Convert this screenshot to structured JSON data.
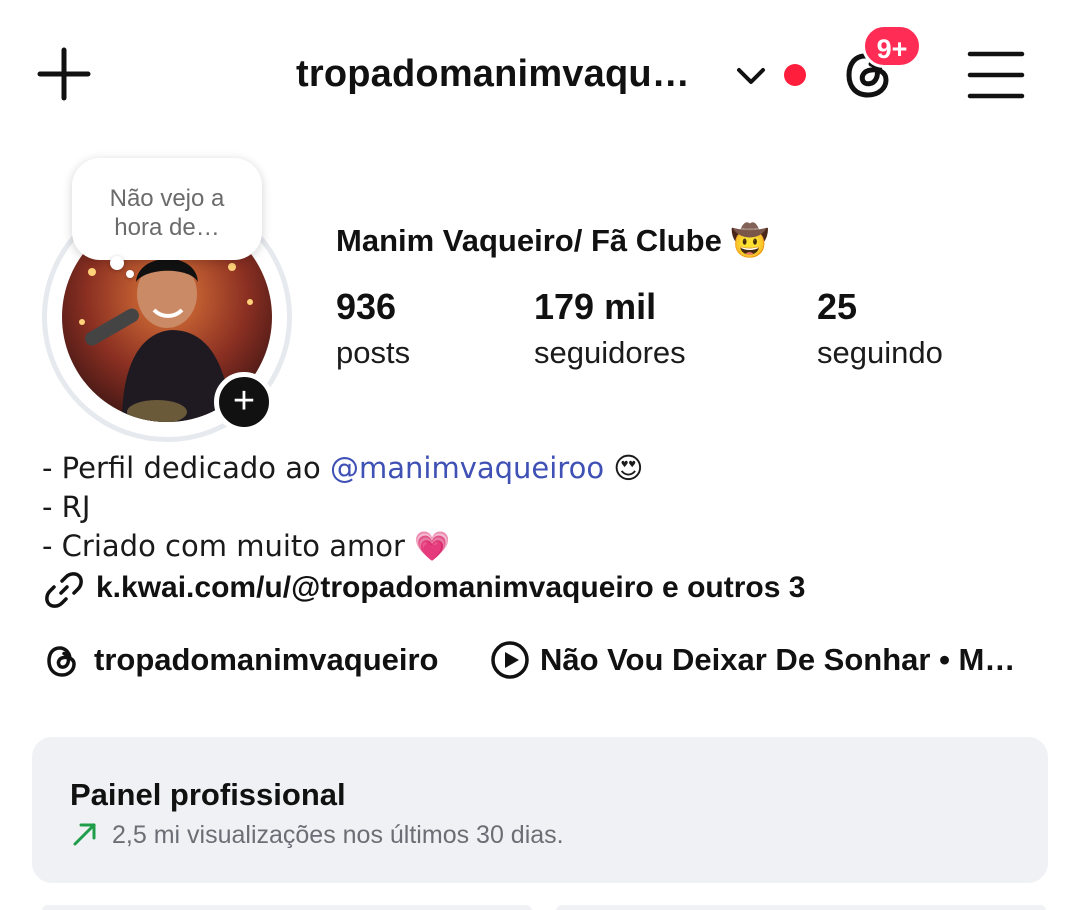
{
  "colors": {
    "text": "#111111",
    "badge_red": "#ff2d55",
    "live_dot": "#ff1e3c",
    "mention_blue": "#3f51b5",
    "trend_green": "#1e9e4a",
    "card_bg": "#eff1f4"
  },
  "header": {
    "new_post_icon": "plus-icon",
    "username": "tropadomanimvaqu…",
    "account_switch_icon": "chevron-down-icon",
    "threads_icon": "threads-icon",
    "notification_badge": "9+",
    "menu_icon": "hamburger-menu-icon"
  },
  "note": {
    "text_line1": "Não vejo a",
    "text_line2": "hora de…"
  },
  "profile": {
    "display_name": "Manim Vaqueiro/ Fã Clube 🤠",
    "add_story_label": "+",
    "stats": [
      {
        "value": "936",
        "label": "posts"
      },
      {
        "value": "179 mil",
        "label": "seguidores"
      },
      {
        "value": "25",
        "label": "seguindo"
      }
    ]
  },
  "bio": {
    "line1_prefix": "- Perfil dedicado ao ",
    "line1_mention": "@manimvaqueiroo",
    "line1_emoji": " 😍",
    "line2": "- RJ",
    "line3": "- Criado com muito amor 💗",
    "link_icon": "link-icon",
    "link_text": "k.kwai.com/u/@tropadomanimvaqueiro e outros 3"
  },
  "badges": {
    "threads_handle": "tropadomanimvaqueiro",
    "music_icon": "play-circle-icon",
    "music_text": "Não Vou Deixar De Sonhar • M…"
  },
  "dashboard": {
    "title": "Painel profissional",
    "trend_icon": "trend-up-arrow-icon",
    "subtitle": "2,5 mi visualizações nos últimos 30 dias."
  }
}
